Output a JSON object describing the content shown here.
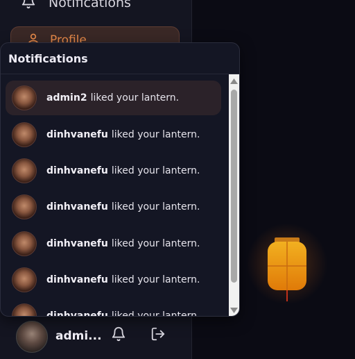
{
  "sidebar": {
    "notifications_label": "Notifications",
    "profile_label": "Profile",
    "user": {
      "name": "admi..."
    }
  },
  "popup": {
    "title": "Notifications",
    "items": [
      {
        "user": "admin2",
        "text": "liked your lantern.",
        "highlighted": true
      },
      {
        "user": "dinhvanefu",
        "text": "liked your lantern."
      },
      {
        "user": "dinhvanefu",
        "text": "liked your lantern."
      },
      {
        "user": "dinhvanefu",
        "text": "liked your lantern."
      },
      {
        "user": "dinhvanefu",
        "text": "liked your lantern."
      },
      {
        "user": "dinhvanefu",
        "text": "liked your lantern."
      },
      {
        "user": "dinhvanefu",
        "text": "liked your lantern."
      }
    ]
  },
  "icons": {
    "bell": "bell-icon",
    "logout": "logout-icon",
    "profile": "user-icon",
    "scroll_up": "triangle-up-icon",
    "scroll_down": "triangle-down-icon"
  },
  "colors": {
    "accent": "#e88a4a",
    "lantern": "#f0a020",
    "lantern_stripe": "#c86a10"
  }
}
